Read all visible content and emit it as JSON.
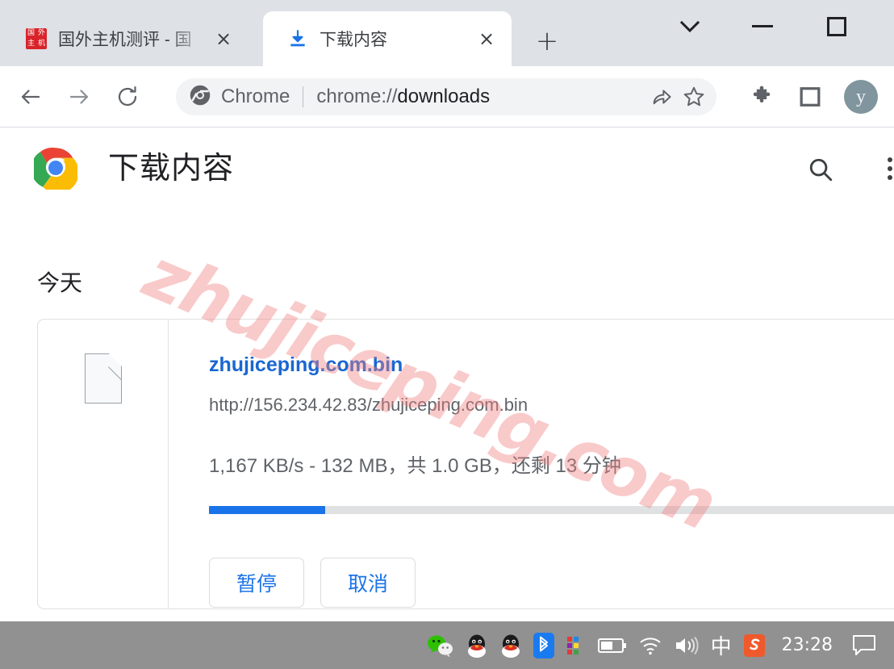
{
  "browser": {
    "tabs": [
      {
        "title": "国外主机测评 - 国",
        "favicon": "red-square-favicon",
        "active": false,
        "close_label": "×"
      },
      {
        "title": "下载内容",
        "favicon": "download-arrow-icon",
        "active": true,
        "close_label": "×"
      }
    ],
    "new_tab_label": "+",
    "window_controls": {
      "tab_search": "tab-search-chevron-icon",
      "minimize": "minimize-icon",
      "maximize": "maximize-icon"
    },
    "toolbar": {
      "back": "back-arrow-icon",
      "forward": "forward-arrow-icon",
      "reload": "reload-icon",
      "omnibox": {
        "site_icon": "chrome-shield-icon",
        "scheme_label": "Chrome",
        "url_prefix": "chrome://",
        "url_main": "downloads",
        "url_full": "chrome://downloads"
      },
      "share": "share-icon",
      "bookmark": "star-icon",
      "extensions": "puzzle-icon",
      "side_panel": "side-panel-icon",
      "avatar_initial": "y"
    }
  },
  "page": {
    "logo": "chrome-logo",
    "title": "下载内容",
    "search_icon": "search-icon",
    "more_menu_icon": "more-vertical-icon",
    "section_date": "今天",
    "watermark": "zhujiceping.com",
    "download": {
      "file_icon": "generic-file-icon",
      "filename": "zhujiceping.com.bin",
      "url": "http://156.234.42.83/zhujiceping.com.bin",
      "status": "1,167 KB/s - 132 MB，共 1.0 GB，还剩 13 分钟",
      "speed": "1,167 KB/s",
      "downloaded": "132 MB",
      "total_size": "1.0 GB",
      "time_remaining": "13 分钟",
      "progress_percent": 14,
      "progress_color": "#1a73e8",
      "buttons": [
        {
          "label": "暂停",
          "name": "pause"
        },
        {
          "label": "取消",
          "name": "cancel"
        }
      ]
    }
  },
  "taskbar": {
    "tray": [
      {
        "name": "wechat-icon",
        "label": "WeChat"
      },
      {
        "name": "qq-icon",
        "label": "QQ"
      },
      {
        "name": "qq-icon-2",
        "label": "QQ"
      },
      {
        "name": "bluetooth-icon",
        "label": "Bluetooth"
      },
      {
        "name": "color-grid-icon",
        "label": "Color Grid"
      },
      {
        "name": "battery-icon",
        "label": "Battery"
      },
      {
        "name": "wifi-icon",
        "label": "Wi-Fi"
      },
      {
        "name": "volume-icon",
        "label": "Volume"
      },
      {
        "name": "ime-icon",
        "label": "中"
      },
      {
        "name": "sogou-icon",
        "label": "S"
      }
    ],
    "clock": "23:28",
    "notification_icon": "notification-icon"
  }
}
